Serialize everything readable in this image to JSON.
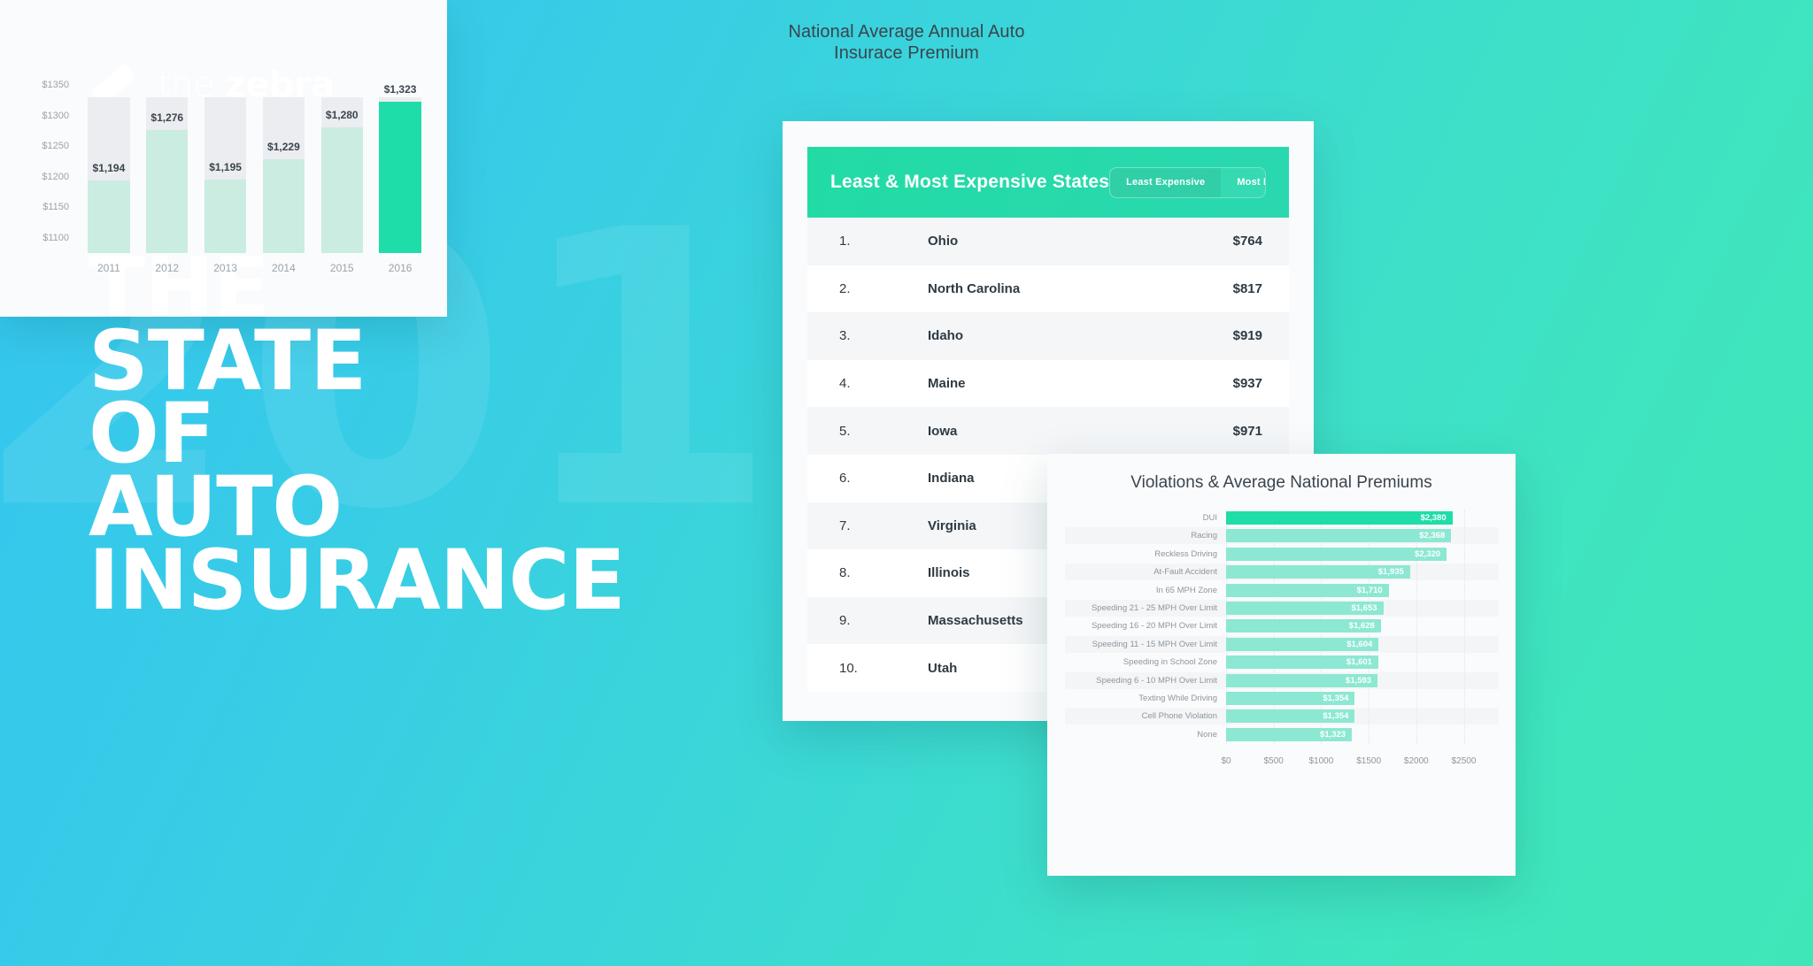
{
  "brand": {
    "logo_icon": "zebra-slash-mark",
    "logo_text_light": "the ",
    "logo_text_bold": "zebra",
    "accent_green": "#1fdda8",
    "accent_green_light": "#8ce8d2",
    "bg_blue": "#34c6ef",
    "bg_teal": "#3fe7b8"
  },
  "hero": {
    "watermark": "2016",
    "line1": "THE",
    "line2": "STATE",
    "line3": "OF",
    "line4": "AUTO",
    "line5": "INSURANCE"
  },
  "states_card": {
    "title": "Least & Most Expensive States",
    "toggle": {
      "least_label": "Least Expensive",
      "most_label": "Most Expensive",
      "selected": "Least Expensive"
    },
    "rows": [
      {
        "rank": "1.",
        "state": "Ohio",
        "price": "$764"
      },
      {
        "rank": "2.",
        "state": "North Carolina",
        "price": "$817"
      },
      {
        "rank": "3.",
        "state": "Idaho",
        "price": "$919"
      },
      {
        "rank": "4.",
        "state": "Maine",
        "price": "$937"
      },
      {
        "rank": "5.",
        "state": "Iowa",
        "price": "$971"
      },
      {
        "rank": "6.",
        "state": "Indiana",
        "price": ""
      },
      {
        "rank": "7.",
        "state": "Virginia",
        "price": ""
      },
      {
        "rank": "8.",
        "state": "Illinois",
        "price": ""
      },
      {
        "rank": "9.",
        "state": "Massachusetts",
        "price": ""
      },
      {
        "rank": "10.",
        "state": "Utah",
        "price": ""
      }
    ]
  },
  "chart_data": [
    {
      "id": "premium_by_year",
      "type": "bar",
      "title": "National Average Annual Auto Insurace Premium",
      "title_line1": "National Average Annual Auto",
      "title_line2": "Insurace Premium",
      "xlabel": "",
      "ylabel": "",
      "categories": [
        "2011",
        "2012",
        "2013",
        "2014",
        "2015",
        "2016"
      ],
      "values": [
        1194,
        1276,
        1195,
        1229,
        1280,
        1323
      ],
      "value_labels": [
        "$1,194",
        "$1,276",
        "$1,195",
        "$1,229",
        "$1,280",
        "$1,323"
      ],
      "yticks": [
        1100,
        1150,
        1200,
        1250,
        1300,
        1350
      ],
      "ytick_labels": [
        "$1100",
        "$1150",
        "$1200",
        "$1250",
        "$1300",
        "$1350"
      ],
      "ylim": [
        1075,
        1350
      ],
      "grid": false,
      "legend": "none",
      "highlight_index": 5,
      "bar_color": "#cbece1",
      "highlight_color": "#1fdda8",
      "track_color": "#ebedf0"
    },
    {
      "id": "violations_premiums",
      "type": "bar",
      "orientation": "horizontal",
      "title": "Violations & Average National Premiums",
      "xlabel": "",
      "ylabel": "",
      "categories": [
        "DUI",
        "Racing",
        "Reckless Driving",
        "At-Fault Accident",
        "In 65 MPH Zone",
        "Speeding 21 - 25 MPH Over Limit",
        "Speeding 16 - 20 MPH Over Limit",
        "Speeding 11 - 15 MPH Over Limit",
        "Speeding in School Zone",
        "Speeding 6 - 10 MPH Over Limit",
        "Texting While Driving",
        "Cell Phone Violation",
        "None"
      ],
      "values": [
        2380,
        2368,
        2320,
        1935,
        1710,
        1653,
        1628,
        1604,
        1601,
        1593,
        1354,
        1354,
        1323
      ],
      "value_labels": [
        "$2,380",
        "$2,368",
        "$2,320",
        "$1,935",
        "$1,710",
        "$1,653",
        "$1,628",
        "$1,604",
        "$1,601",
        "$1,593",
        "$1,354",
        "$1,354",
        "$1,323"
      ],
      "xticks": [
        0,
        500,
        1000,
        1500,
        2000,
        2500
      ],
      "xtick_labels": [
        "$0",
        "$500",
        "$1000",
        "$1500",
        "$2000",
        "$2500"
      ],
      "xlim": [
        0,
        2700
      ],
      "grid": true,
      "legend": "none",
      "highlight_index": 0,
      "bar_color": "#8ce8d2",
      "highlight_color": "#1fdda8"
    }
  ]
}
